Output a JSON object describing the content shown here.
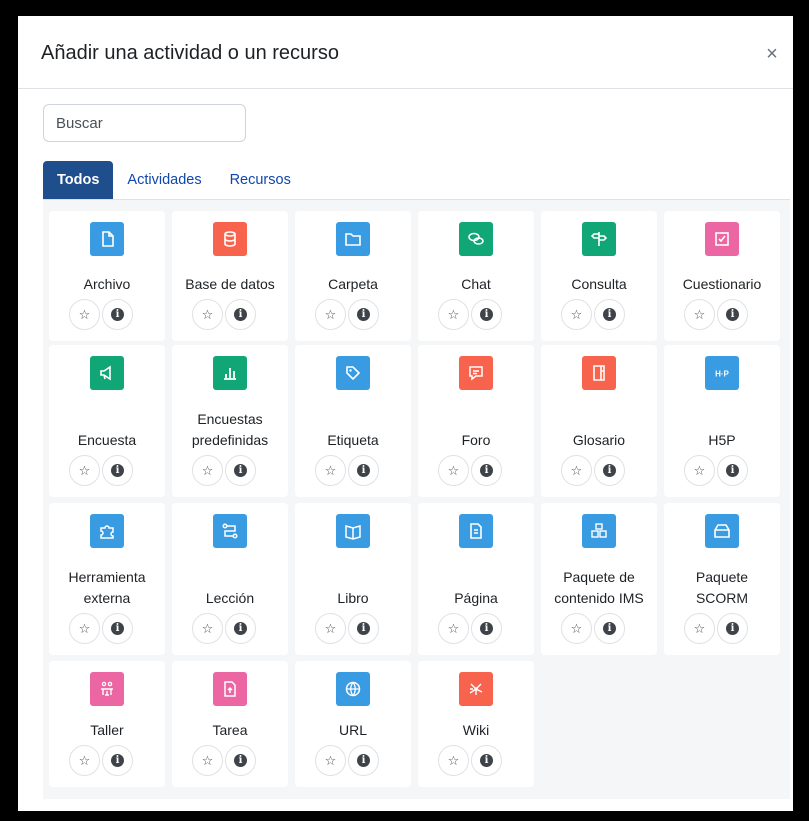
{
  "modal": {
    "title": "Añadir una actividad o un recurso",
    "close_label": "×"
  },
  "search": {
    "placeholder": "Buscar"
  },
  "tabs": [
    {
      "label": "Todos",
      "active": true
    },
    {
      "label": "Actividades",
      "active": false
    },
    {
      "label": "Recursos",
      "active": false
    }
  ],
  "items": [
    {
      "label": "Archivo",
      "icon": "file-icon",
      "color": "#399be2"
    },
    {
      "label": "Base de datos",
      "icon": "database-icon",
      "color": "#f7634d"
    },
    {
      "label": "Carpeta",
      "icon": "folder-icon",
      "color": "#399be2"
    },
    {
      "label": "Chat",
      "icon": "chat-icon",
      "color": "#11a676"
    },
    {
      "label": "Consulta",
      "icon": "signpost-icon",
      "color": "#11a676"
    },
    {
      "label": "Cuestionario",
      "icon": "checkbox-icon",
      "color": "#eb66a2"
    },
    {
      "label": "Encuesta",
      "icon": "megaphone-icon",
      "color": "#11a676"
    },
    {
      "label": "Encuestas\npredefinidas",
      "icon": "bar-chart-icon",
      "color": "#11a676"
    },
    {
      "label": "Etiqueta",
      "icon": "tag-icon",
      "color": "#399be2"
    },
    {
      "label": "Foro",
      "icon": "forum-icon",
      "color": "#f7634d"
    },
    {
      "label": "Glosario",
      "icon": "glossary-book-icon",
      "color": "#f7634d"
    },
    {
      "label": "H5P",
      "icon": "h5p-icon",
      "color": "#399be2"
    },
    {
      "label": "Herramienta\nexterna",
      "icon": "puzzle-icon",
      "color": "#399be2"
    },
    {
      "label": "Lección",
      "icon": "lesson-path-icon",
      "color": "#399be2"
    },
    {
      "label": "Libro",
      "icon": "book-icon",
      "color": "#399be2"
    },
    {
      "label": "Página",
      "icon": "page-icon",
      "color": "#399be2"
    },
    {
      "label": "Paquete de\ncontenido IMS",
      "icon": "package-icon",
      "color": "#399be2"
    },
    {
      "label": "Paquete\nSCORM",
      "icon": "box-icon",
      "color": "#399be2"
    },
    {
      "label": "Taller",
      "icon": "workshop-icon",
      "color": "#eb66a2"
    },
    {
      "label": "Tarea",
      "icon": "assignment-icon",
      "color": "#eb66a2"
    },
    {
      "label": "URL",
      "icon": "globe-icon",
      "color": "#399be2"
    },
    {
      "label": "Wiki",
      "icon": "wiki-network-icon",
      "color": "#f7634d"
    }
  ]
}
